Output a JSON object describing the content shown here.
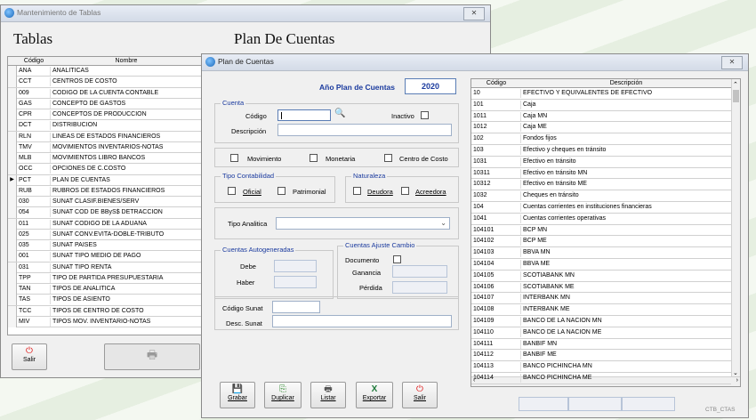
{
  "left_window": {
    "title": "Mantenimiento de Tablas",
    "heading": "Tablas",
    "heading_right": "Plan De Cuentas",
    "columns": [
      "Código",
      "Nombre"
    ],
    "rows": [
      [
        "ANA",
        "ANALITICAS"
      ],
      [
        "CCT",
        "CENTROS DE COSTO"
      ],
      [
        "009",
        "CODIGO DE LA CUENTA CONTABLE"
      ],
      [
        "GAS",
        "CONCEPTO DE GASTOS"
      ],
      [
        "CPR",
        "CONCEPTOS DE PRODUCCION"
      ],
      [
        "DCT",
        "DISTRIBUCION"
      ],
      [
        "RLN",
        "LINEAS DE ESTADOS FINANCIEROS"
      ],
      [
        "TMV",
        "MOVIMIENTOS INVENTARIOS-NOTAS"
      ],
      [
        "MLB",
        "MOVIMIENTOS LIBRO BANCOS"
      ],
      [
        "OCC",
        "OPCIONES DE C.COSTO"
      ],
      [
        "PCT",
        "PLAN DE CUENTAS"
      ],
      [
        "RUB",
        "RUBROS DE ESTADOS FINANCIEROS"
      ],
      [
        "030",
        "SUNAT CLASIF.BIENES/SERV"
      ],
      [
        "054",
        "SUNAT COD DE BByS$ DETRACCION"
      ],
      [
        "011",
        "SUNAT CODIGO DE LA ADUANA"
      ],
      [
        "025",
        "SUNAT CONV.EVITA-DOBLE-TRIBUTO"
      ],
      [
        "035",
        "SUNAT PAISES"
      ],
      [
        "001",
        "SUNAT TIPO MEDIO DE PAGO"
      ],
      [
        "031",
        "SUNAT TIPO RENTA"
      ],
      [
        "TPP",
        "TIPO DE PARTIDA PRESUPUESTARIA"
      ],
      [
        "TAN",
        "TIPOS DE ANALITICA"
      ],
      [
        "TAS",
        "TIPOS DE ASIENTO"
      ],
      [
        "TCC",
        "TIPOS DE CENTRO DE COSTO"
      ],
      [
        "MIV",
        "TIPOS MOV. INVENTARIO-NOTAS"
      ]
    ],
    "current_row_marker": "▶",
    "salir_label": "Salir",
    "close_label": "✕"
  },
  "plan_window": {
    "title": "Plan de Cuentas",
    "close_label": "✕",
    "anio_label": "Año Plan de Cuentas",
    "anio_value": "2020",
    "cuenta_group": "Cuenta",
    "codigo_label": "Código",
    "inactivo_label": "Inactivo",
    "descripcion_label": "Descripción",
    "movimiento_label": "Movimiento",
    "monetaria_label": "Monetaria",
    "centro_costo_label": "Centro de Costo",
    "tipo_contabilidad_group": "Tipo Contabilidad",
    "oficial_label": "Oficial",
    "patrimonial_label": "Patrimonial",
    "naturaleza_group": "Naturaleza",
    "deudora_label": "Deudora",
    "acreedora_label": "Acreedora",
    "tipo_analitica_label": "Tipo Analitica",
    "autogeneradas_group": "Cuentas Autogeneradas",
    "debe_label": "Debe",
    "haber_label": "Haber",
    "ajuste_group": "Cuentas Ajuste Cambio",
    "documento_label": "Documento",
    "ganancia_label": "Ganancia",
    "perdida_label": "Pérdida",
    "codigo_sunat_label": "Código Sunat",
    "desc_sunat_label": "Desc. Sunat",
    "buttons": [
      "Grabar",
      "Duplicar",
      "Listar",
      "Exportar",
      "Salir"
    ],
    "grid_columns": [
      "Código",
      "Descripción"
    ],
    "accounts": [
      [
        "10",
        "EFECTIVO Y EQUIVALENTES DE EFECTIVO"
      ],
      [
        "101",
        "Caja"
      ],
      [
        "1011",
        "Caja MN"
      ],
      [
        "1012",
        "Caja ME"
      ],
      [
        "102",
        "Fondos fijos"
      ],
      [
        "103",
        "Efectivo y cheques en tránsito"
      ],
      [
        "1031",
        "Efectivo en tránsito"
      ],
      [
        "10311",
        "Efectivo en tránsito MN"
      ],
      [
        "10312",
        "Efectivo en tránsito ME"
      ],
      [
        "1032",
        "Cheques en tránsito"
      ],
      [
        "104",
        "Cuentas corrientes en instituciones financieras"
      ],
      [
        "1041",
        "Cuentas corrientes operativas"
      ],
      [
        "104101",
        "BCP MN"
      ],
      [
        "104102",
        "BCP ME"
      ],
      [
        "104103",
        "BBVA MN"
      ],
      [
        "104104",
        "BBVA ME"
      ],
      [
        "104105",
        "SCOTIABANK MN"
      ],
      [
        "104106",
        "SCOTIABANK ME"
      ],
      [
        "104107",
        "INTERBANK MN"
      ],
      [
        "104108",
        "INTERBANK ME"
      ],
      [
        "104109",
        "BANCO DE LA NACION MN"
      ],
      [
        "104110",
        "BANCO DE LA NACION ME"
      ],
      [
        "104111",
        "BANBIF MN"
      ],
      [
        "104112",
        "BANBIF ME"
      ],
      [
        "104113",
        "BANCO PICHINCHA MN"
      ],
      [
        "104114",
        "BANCO PICHINCHA ME"
      ]
    ],
    "status_code": "CTB_CTAS"
  }
}
